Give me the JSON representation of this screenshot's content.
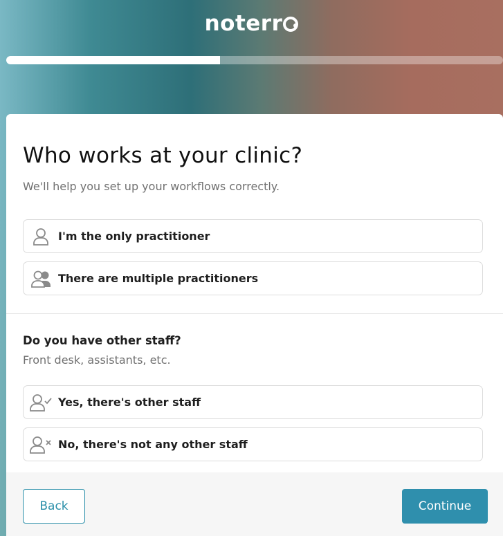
{
  "brand": {
    "logo_text": "noterr"
  },
  "progress": {
    "fraction": 0.43
  },
  "form": {
    "title": "Who works at your clinic?",
    "subtitle": "We'll help you set up your workflows correctly.",
    "practitioner_options": [
      {
        "label": "I'm the only practitioner",
        "icon": "person-icon"
      },
      {
        "label": "There are multiple practitioners",
        "icon": "people-icon"
      }
    ],
    "staff_question": "Do you have other staff?",
    "staff_hint": "Front desk, assistants, etc.",
    "staff_options": [
      {
        "label": "Yes, there's other staff",
        "icon": "person-check-icon"
      },
      {
        "label": "No, there's not any other staff",
        "icon": "person-x-icon"
      }
    ]
  },
  "footer": {
    "back_label": "Back",
    "continue_label": "Continue"
  },
  "colors": {
    "accent": "#2f8fad",
    "border": "#dcdcdc",
    "muted_text": "#707070"
  }
}
